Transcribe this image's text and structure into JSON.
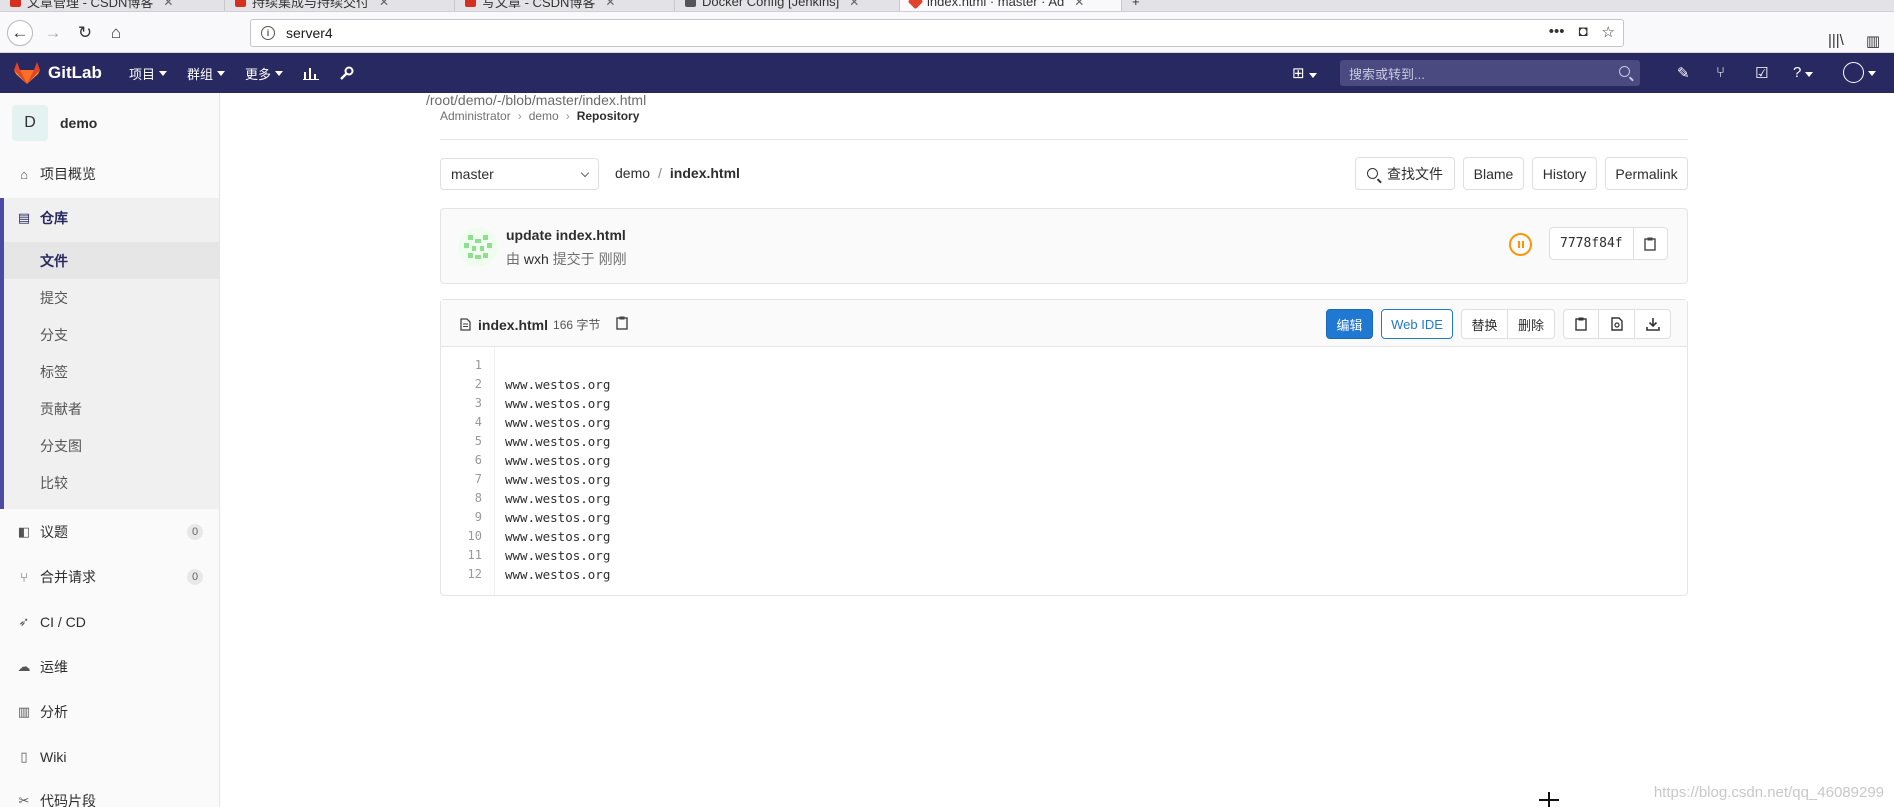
{
  "browser": {
    "tabs": [
      {
        "label": "文章管理 - CSDN博客"
      },
      {
        "label": "持续集成与持续交付"
      },
      {
        "label": "写文章 - CSDN博客"
      },
      {
        "label": "Docker Config [Jenkins]"
      },
      {
        "label": "index.html · master · Ad"
      }
    ],
    "url_host": "server4",
    "url_path": "/root/demo/-/blob/master/index.html"
  },
  "header": {
    "brand": "GitLab",
    "menu": [
      "项目",
      "群组",
      "更多"
    ],
    "search_placeholder": "搜索或转到..."
  },
  "sidebar": {
    "project_initial": "D",
    "project_name": "demo",
    "overview": "项目概览",
    "repository": "仓库",
    "repo_items": [
      "文件",
      "提交",
      "分支",
      "标签",
      "贡献者",
      "分支图",
      "比较"
    ],
    "issues": {
      "label": "议题",
      "count": "0"
    },
    "merge_requests": {
      "label": "合并请求",
      "count": "0"
    },
    "cicd": "CI / CD",
    "operations": "运维",
    "analytics": "分析",
    "wiki": "Wiki",
    "snippets": "代码片段"
  },
  "breadcrumb": [
    "Administrator",
    "demo",
    "Repository"
  ],
  "tree": {
    "branch": "master",
    "path_root": "demo",
    "path_file": "index.html",
    "actions": {
      "find": "查找文件",
      "blame": "Blame",
      "history": "History",
      "permalink": "Permalink"
    }
  },
  "commit": {
    "title": "update index.html",
    "meta_prefix": "由",
    "author": "wxh",
    "meta_suffix": "提交于 刚刚",
    "sha": "7778f84f"
  },
  "file": {
    "name": "index.html",
    "size": "166 字节",
    "buttons": {
      "edit": "编辑",
      "webide": "Web IDE",
      "replace": "替换",
      "delete": "删除"
    },
    "lines": [
      "",
      "www.westos.org",
      "www.westos.org",
      "www.westos.org",
      "www.westos.org",
      "www.westos.org",
      "www.westos.org",
      "www.westos.org",
      "www.westos.org",
      "www.westos.org",
      "www.westos.org",
      "www.westos.org"
    ]
  },
  "watermark": "https://blog.csdn.net/qq_46089299",
  "colors": {
    "header": "#292961",
    "primary": "#1f78d1",
    "pipeline_pending": "#fc9403"
  }
}
